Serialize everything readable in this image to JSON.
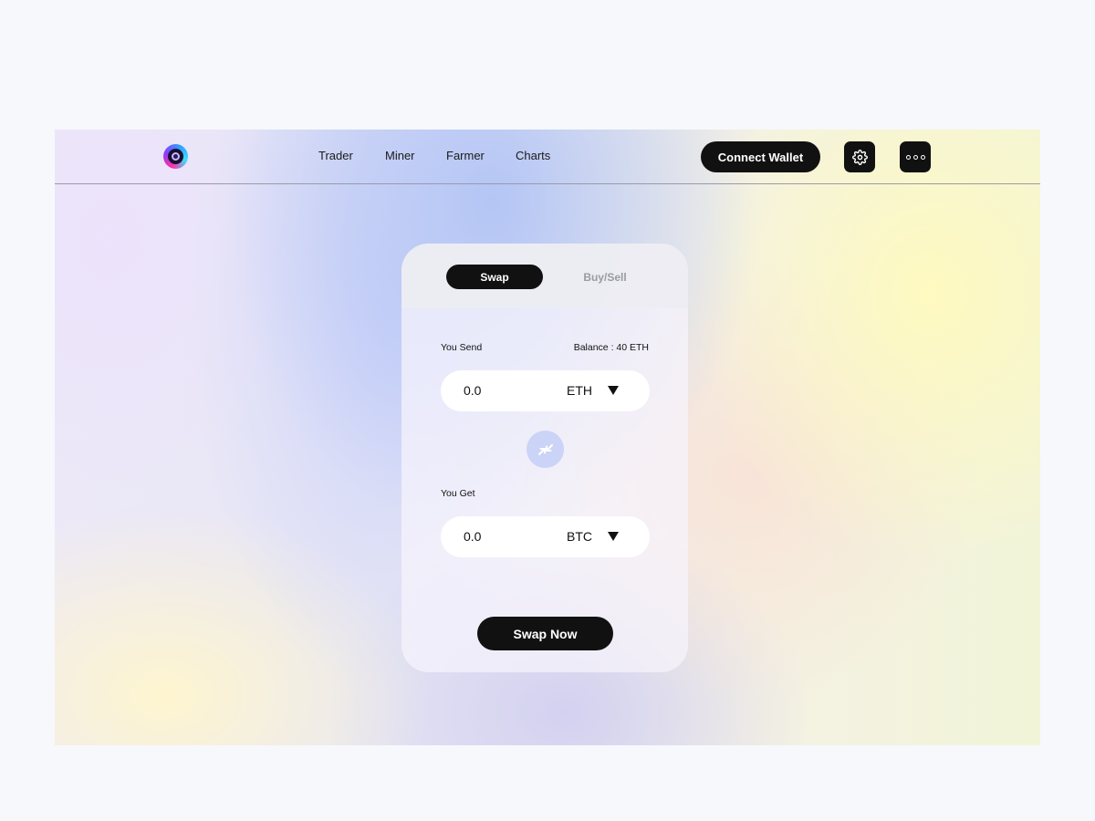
{
  "nav": {
    "links": [
      "Trader",
      "Miner",
      "Farmer",
      "Charts"
    ],
    "connect_label": "Connect Wallet",
    "settings_icon": "gear-icon",
    "more_icon": "more-dots-icon"
  },
  "swap_card": {
    "tabs": {
      "active": "Swap",
      "inactive": "Buy/Sell"
    },
    "send": {
      "label": "You Send",
      "balance": "Balance : 40 ETH",
      "amount": "0.0",
      "token": "ETH"
    },
    "get": {
      "label": "You Get",
      "amount": "0.0",
      "token": "BTC"
    },
    "switch_icon": "swap-arrows-icon",
    "submit_label": "Swap Now"
  },
  "colors": {
    "primary_dark": "#111111",
    "switch_bg": "#cbd4f7",
    "inactive_tab": "#9a9aa2"
  }
}
